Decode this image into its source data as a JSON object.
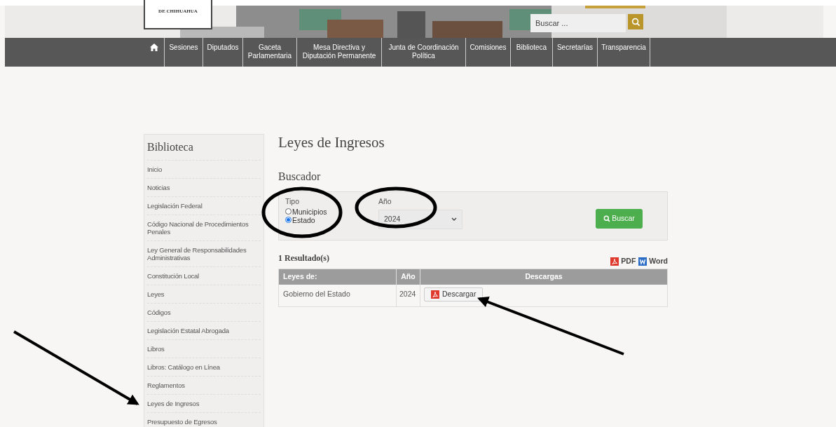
{
  "header": {
    "logo_text": "DE CHIHUAHUA",
    "search": {
      "placeholder": "Buscar ..."
    }
  },
  "nav": {
    "items": [
      "Sesiones",
      "Diputados",
      "Gaceta Parlamentaria",
      "Mesa Directiva y Diputación Permanente",
      "Junta de Coordinación Política",
      "Comisiones",
      "Biblioteca",
      "Secretarías",
      "Transparencia"
    ]
  },
  "sidebar": {
    "title": "Biblioteca",
    "items": [
      "Inicio",
      "Noticias",
      "Legislación Federal",
      "Código Nacional de Procedimientos Penales",
      "Ley General de Responsabilidades Administrativas",
      "Constitución Local",
      "Leyes",
      "Códigos",
      "Legislación Estatal Abrogada",
      "Libros",
      "Libros: Catálogo en Línea",
      "Reglamentos",
      "Leyes de Ingresos",
      "Presupuesto de Egresos"
    ]
  },
  "page_title": "Leyes de Ingresos",
  "search_form": {
    "title": "Buscador",
    "tipo_label": "Tipo",
    "options": [
      {
        "label": "Municipios",
        "selected": false
      },
      {
        "label": "Estado",
        "selected": true
      }
    ],
    "year_label": "Año",
    "year_value": "2024",
    "button": "Buscar"
  },
  "results": {
    "count": "1 Resultado(s)",
    "exports": [
      {
        "kind": "pdf",
        "label": "PDF"
      },
      {
        "kind": "word",
        "label": "Word"
      }
    ],
    "columns": [
      "Leyes de:",
      "Año",
      "Descargas"
    ],
    "rows": [
      {
        "name": "Gobierno del Estado",
        "year": "2024",
        "download": "Descargar"
      }
    ]
  }
}
